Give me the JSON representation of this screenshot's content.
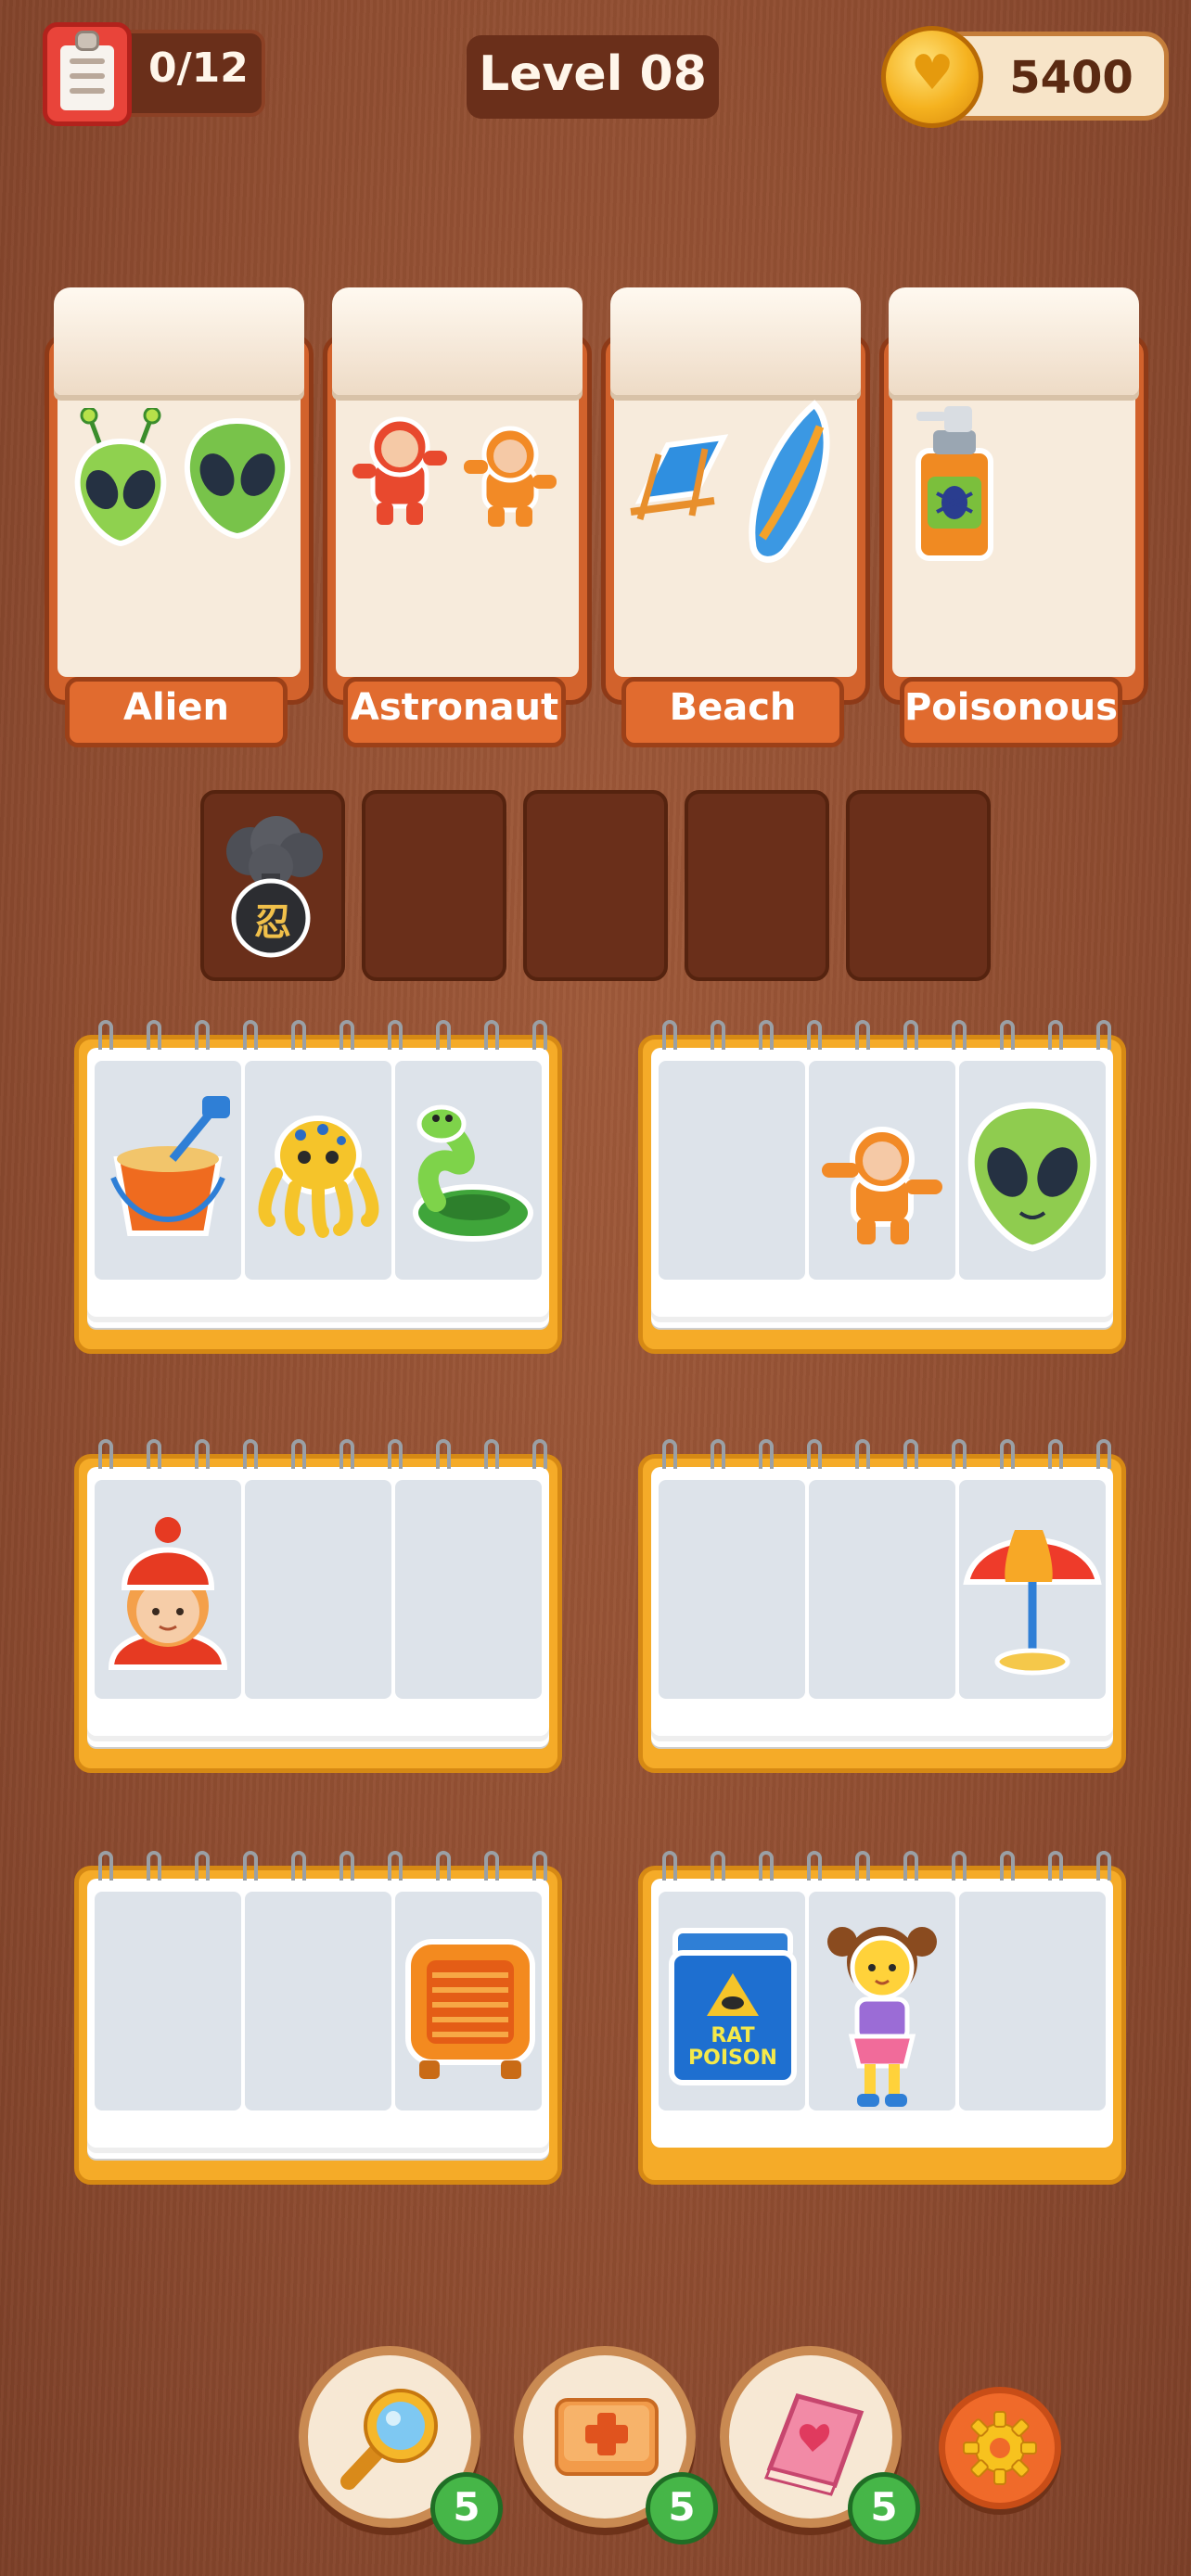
{
  "header": {
    "task_count": "0/12",
    "level": "Level 08",
    "coins": "5400"
  },
  "categories": [
    {
      "label": "Alien",
      "icons": [
        "alien-antenna-icon",
        "alien-head-icon"
      ]
    },
    {
      "label": "Astronaut",
      "icons": [
        "astronaut-red-icon",
        "astronaut-orange-icon"
      ]
    },
    {
      "label": "Beach",
      "icons": [
        "beach-chair-icon",
        "surfboard-icon"
      ]
    },
    {
      "label": "Poisonous",
      "icons": [
        "bug-spray-icon"
      ]
    }
  ],
  "holding_slots": [
    {
      "item": "smoke-bomb-icon",
      "glyph": "忍"
    },
    {
      "item": null
    },
    {
      "item": null
    },
    {
      "item": null
    },
    {
      "item": null
    }
  ],
  "notebooks": [
    {
      "slots": [
        "sand-bucket-icon",
        "octopus-icon",
        "snake-icon"
      ]
    },
    {
      "slots": [
        null,
        "astronaut-icon",
        "alien-head-icon"
      ]
    },
    {
      "slots": [
        "girl-red-beanie-icon",
        null,
        null
      ]
    },
    {
      "slots": [
        null,
        null,
        "beach-umbrella-icon"
      ]
    },
    {
      "slots": [
        null,
        null,
        "heater-icon"
      ]
    },
    {
      "slots": [
        "rat-poison-box-icon",
        "girl-pigtails-icon",
        null
      ]
    }
  ],
  "rat_poison_text": "RAT POISON",
  "boosters": [
    {
      "name": "magnifier-icon",
      "count": "5"
    },
    {
      "name": "add-slot-icon",
      "count": "5"
    },
    {
      "name": "book-icon",
      "count": "5"
    }
  ],
  "settings_icon": "gear-icon",
  "colors": {
    "background": "#8e4c30",
    "category_orange": "#e16b2f",
    "notebook_yellow": "#f5ab28",
    "badge_green": "#46b648"
  }
}
